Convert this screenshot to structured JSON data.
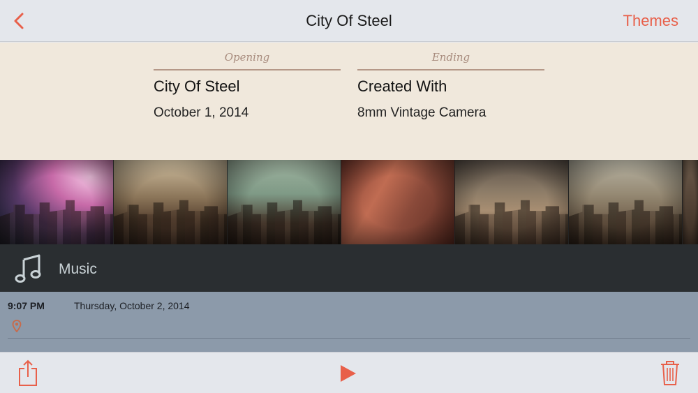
{
  "nav": {
    "title": "City Of Steel",
    "right_action": "Themes",
    "back_icon": "chevron-left-icon"
  },
  "title_card": {
    "opening": {
      "header": "Opening",
      "line1": "City Of Steel",
      "line2": "October 1, 2014"
    },
    "ending": {
      "header": "Ending",
      "line1": "Created With",
      "line2": "8mm Vintage Camera"
    }
  },
  "photo_strip": {
    "count": 7
  },
  "music": {
    "label": "Music",
    "icon": "music-note-icon"
  },
  "meta": {
    "time": "9:07 PM",
    "date": "Thursday, October 2, 2014",
    "location_icon": "map-pin-icon"
  },
  "toolbar": {
    "share_icon": "share-icon",
    "play_icon": "play-icon",
    "trash_icon": "trash-icon"
  },
  "colors": {
    "accent": "#e8604a",
    "music_bar": "#2a2e31",
    "meta_bg": "#8c9aaa",
    "card_bg": "#f0e8dc"
  }
}
